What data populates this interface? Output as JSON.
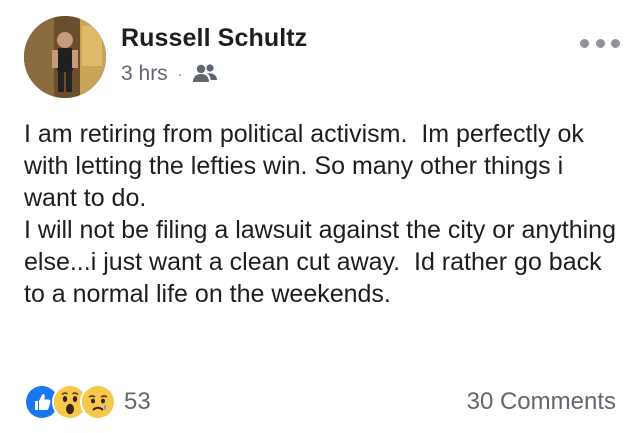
{
  "post": {
    "author": "Russell Schultz",
    "time": "3 hrs",
    "separator": "·",
    "audience_icon": "friends-icon",
    "more_icon": "more-options-icon",
    "body_lines": [
      "I am retiring from political activism.  Im perfectly ok with letting the lefties win. So many other things i want to do.",
      "I will not be filing a lawsuit against the city or anything else...i just want a clean cut away.  Id rather go back to a normal life on the weekends."
    ]
  },
  "footer": {
    "reactions": [
      "like",
      "wow",
      "sad"
    ],
    "reaction_count": "53",
    "comments": "30 Comments"
  },
  "colors": {
    "text_primary": "#1c1e21",
    "text_secondary": "#606770",
    "like_blue": "#1877f2",
    "emoji_yellow": "#f7c94a"
  }
}
